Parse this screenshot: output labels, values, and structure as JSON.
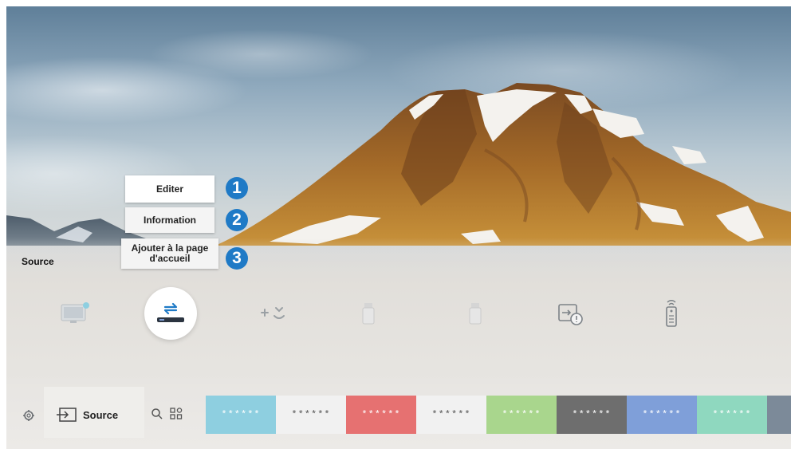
{
  "context_menu": {
    "items": [
      {
        "label": "Editer",
        "number": "1"
      },
      {
        "label": "Information",
        "number": "2"
      },
      {
        "label": "Ajouter à la page d'accueil",
        "number": "3"
      }
    ]
  },
  "source_panel": {
    "title": "Source",
    "tiles": [
      {
        "icon": "tv-icon"
      },
      {
        "icon": "bluray-player-icon"
      },
      {
        "icon": "game-console-icon"
      },
      {
        "icon": "usb-device-icon"
      },
      {
        "icon": "usb-device-icon"
      },
      {
        "icon": "connection-guide-icon"
      },
      {
        "icon": "remote-icon"
      }
    ]
  },
  "bottom_bar": {
    "source_label": "Source",
    "app_tiles": [
      {
        "label": "******",
        "color": "#8ecfe0",
        "text_color": "#ffffff"
      },
      {
        "label": "******",
        "color": "#f1f1f1",
        "text_color": "#555555"
      },
      {
        "label": "******",
        "color": "#e67171",
        "text_color": "#ffffff"
      },
      {
        "label": "******",
        "color": "#f1f1f1",
        "text_color": "#555555"
      },
      {
        "label": "******",
        "color": "#a9d68d",
        "text_color": "#ffffff"
      },
      {
        "label": "******",
        "color": "#6e6e6e",
        "text_color": "#ffffff"
      },
      {
        "label": "******",
        "color": "#7f9fd9",
        "text_color": "#ffffff"
      },
      {
        "label": "******",
        "color": "#8fd8bf",
        "text_color": "#ffffff"
      },
      {
        "label": "**",
        "color": "#7c8a99",
        "text_color": "#ffffff"
      }
    ]
  },
  "colors": {
    "badge": "#1f7ac6",
    "focus": "#ffffff"
  }
}
